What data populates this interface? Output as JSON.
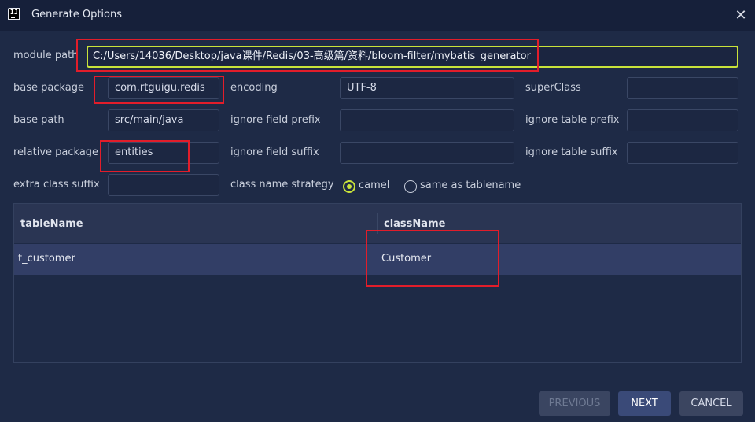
{
  "window": {
    "title": "Generate Options",
    "close_glyph": "✕",
    "icon_text": "IJ"
  },
  "form": {
    "module_path": {
      "label": "module path",
      "value": "C:/Users/14036/Desktop/java课件/Redis/03-高级篇/资料/bloom-filter/mybatis_generator"
    },
    "base_package": {
      "label": "base package",
      "value": "com.rtguigu.redis"
    },
    "base_path": {
      "label": "base path",
      "value": "src/main/java"
    },
    "relative_package": {
      "label": "relative package",
      "value": "entities"
    },
    "extra_class_suffix": {
      "label": "extra class suffix",
      "value": ""
    },
    "encoding": {
      "label": "encoding",
      "value": "UTF-8"
    },
    "ignore_field_prefix": {
      "label": "ignore field prefix",
      "value": ""
    },
    "ignore_field_suffix": {
      "label": "ignore field suffix",
      "value": ""
    },
    "super_class": {
      "label": "superClass",
      "value": ""
    },
    "ignore_table_prefix": {
      "label": "ignore table prefix",
      "value": ""
    },
    "ignore_table_suffix": {
      "label": "ignore table suffix",
      "value": ""
    },
    "class_name_strategy": {
      "label": "class name strategy",
      "options": [
        {
          "label": "camel",
          "selected": true
        },
        {
          "label": "same as tablename",
          "selected": false
        }
      ]
    }
  },
  "table": {
    "columns": [
      "tableName",
      "className"
    ],
    "rows": [
      {
        "tableName": "t_customer",
        "className": "Customer"
      }
    ]
  },
  "buttons": {
    "previous": "PREVIOUS",
    "next": "NEXT",
    "cancel": "CANCEL"
  },
  "colors": {
    "background": "#1e2a46",
    "focus_accent": "#c9e33a",
    "annotation_red": "#e21d2a",
    "selected_row": "#323e66"
  }
}
